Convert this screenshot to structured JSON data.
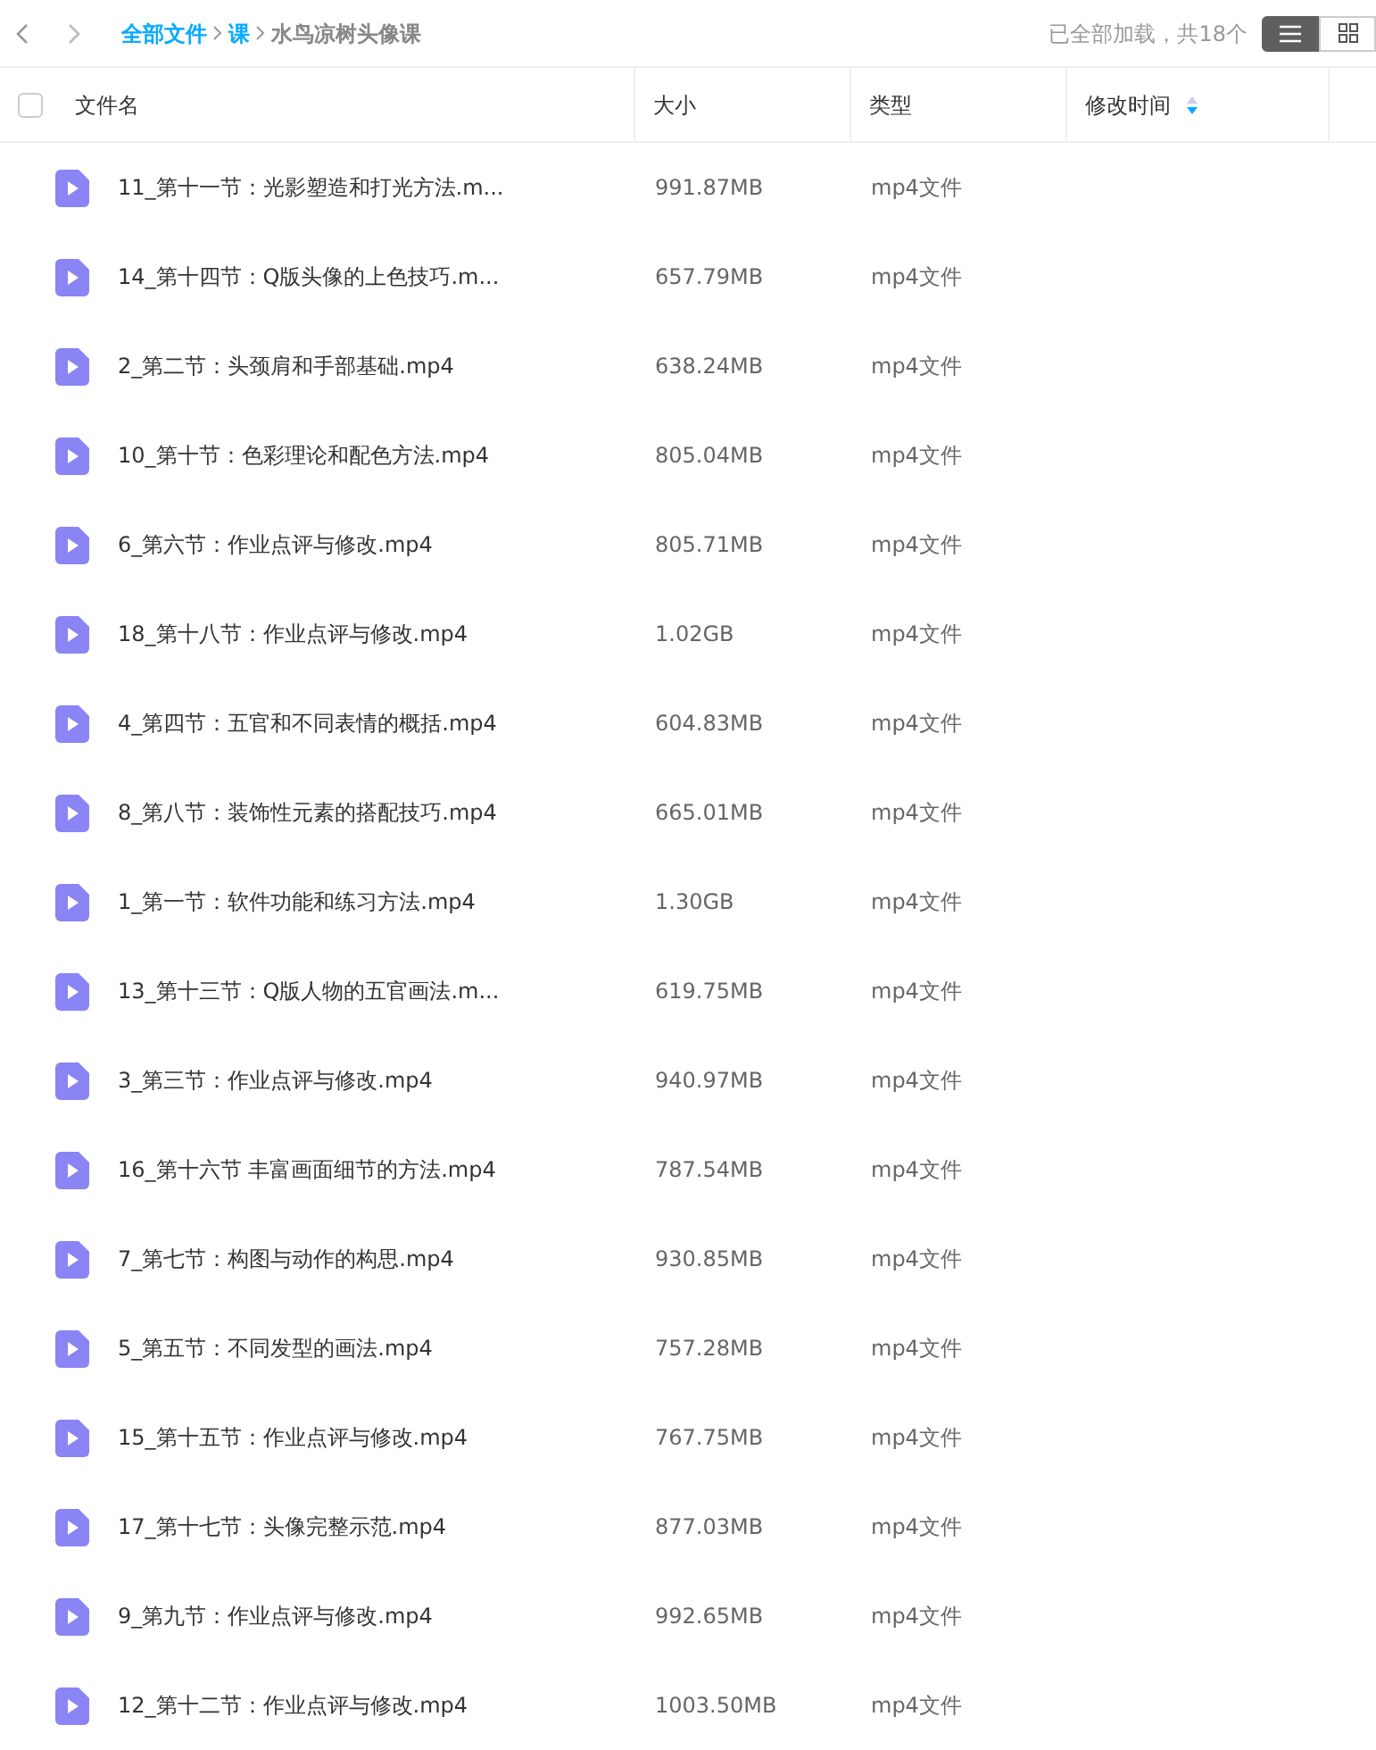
{
  "breadcrumb": [
    {
      "label": "全部文件",
      "current": false
    },
    {
      "label": "课",
      "current": false
    },
    {
      "label": "水鸟凉树头像课",
      "current": true
    }
  ],
  "status": "已全部加载，共18个",
  "view_buttons": [
    {
      "kind": "list",
      "selected": true
    },
    {
      "kind": "grid",
      "selected": false
    }
  ],
  "table": {
    "select_all": {
      "checked": false
    },
    "columns": [
      {
        "label": "文件名",
        "sortable": false
      },
      {
        "label": "大小",
        "sortable": false
      },
      {
        "label": "类型",
        "sortable": false
      },
      {
        "label": "修改时间",
        "sortable": true
      }
    ],
    "rows": [
      {
        "name": "11_第十一节：光影塑造和打光方法.m...",
        "size": "991.87MB",
        "type": "mp4文件"
      },
      {
        "name": "14_第十四节：Q版头像的上色技巧.m...",
        "size": "657.79MB",
        "type": "mp4文件"
      },
      {
        "name": "2_第二节：头颈肩和手部基础.mp4",
        "size": "638.24MB",
        "type": "mp4文件"
      },
      {
        "name": "10_第十节：色彩理论和配色方法.mp4",
        "size": "805.04MB",
        "type": "mp4文件"
      },
      {
        "name": "6_第六节：作业点评与修改.mp4",
        "size": "805.71MB",
        "type": "mp4文件"
      },
      {
        "name": "18_第十八节：作业点评与修改.mp4",
        "size": "1.02GB",
        "type": "mp4文件"
      },
      {
        "name": "4_第四节：五官和不同表情的概括.mp4",
        "size": "604.83MB",
        "type": "mp4文件"
      },
      {
        "name": "8_第八节：装饰性元素的搭配技巧.mp4",
        "size": "665.01MB",
        "type": "mp4文件"
      },
      {
        "name": "1_第一节：软件功能和练习方法.mp4",
        "size": "1.30GB",
        "type": "mp4文件"
      },
      {
        "name": "13_第十三节：Q版人物的五官画法.m...",
        "size": "619.75MB",
        "type": "mp4文件"
      },
      {
        "name": "3_第三节：作业点评与修改.mp4",
        "size": "940.97MB",
        "type": "mp4文件"
      },
      {
        "name": "16_第十六节 丰富画面细节的方法.mp4",
        "size": "787.54MB",
        "type": "mp4文件"
      },
      {
        "name": "7_第七节：构图与动作的构思.mp4",
        "size": "930.85MB",
        "type": "mp4文件"
      },
      {
        "name": "5_第五节：不同发型的画法.mp4",
        "size": "757.28MB",
        "type": "mp4文件"
      },
      {
        "name": "15_第十五节：作业点评与修改.mp4",
        "size": "767.75MB",
        "type": "mp4文件"
      },
      {
        "name": "17_第十七节：头像完整示范.mp4",
        "size": "877.03MB",
        "type": "mp4文件"
      },
      {
        "name": "9_第九节：作业点评与修改.mp4",
        "size": "992.65MB",
        "type": "mp4文件"
      },
      {
        "name": "12_第十二节：作业点评与修改.mp4",
        "size": "1003.50MB",
        "type": "mp4文件"
      }
    ]
  }
}
